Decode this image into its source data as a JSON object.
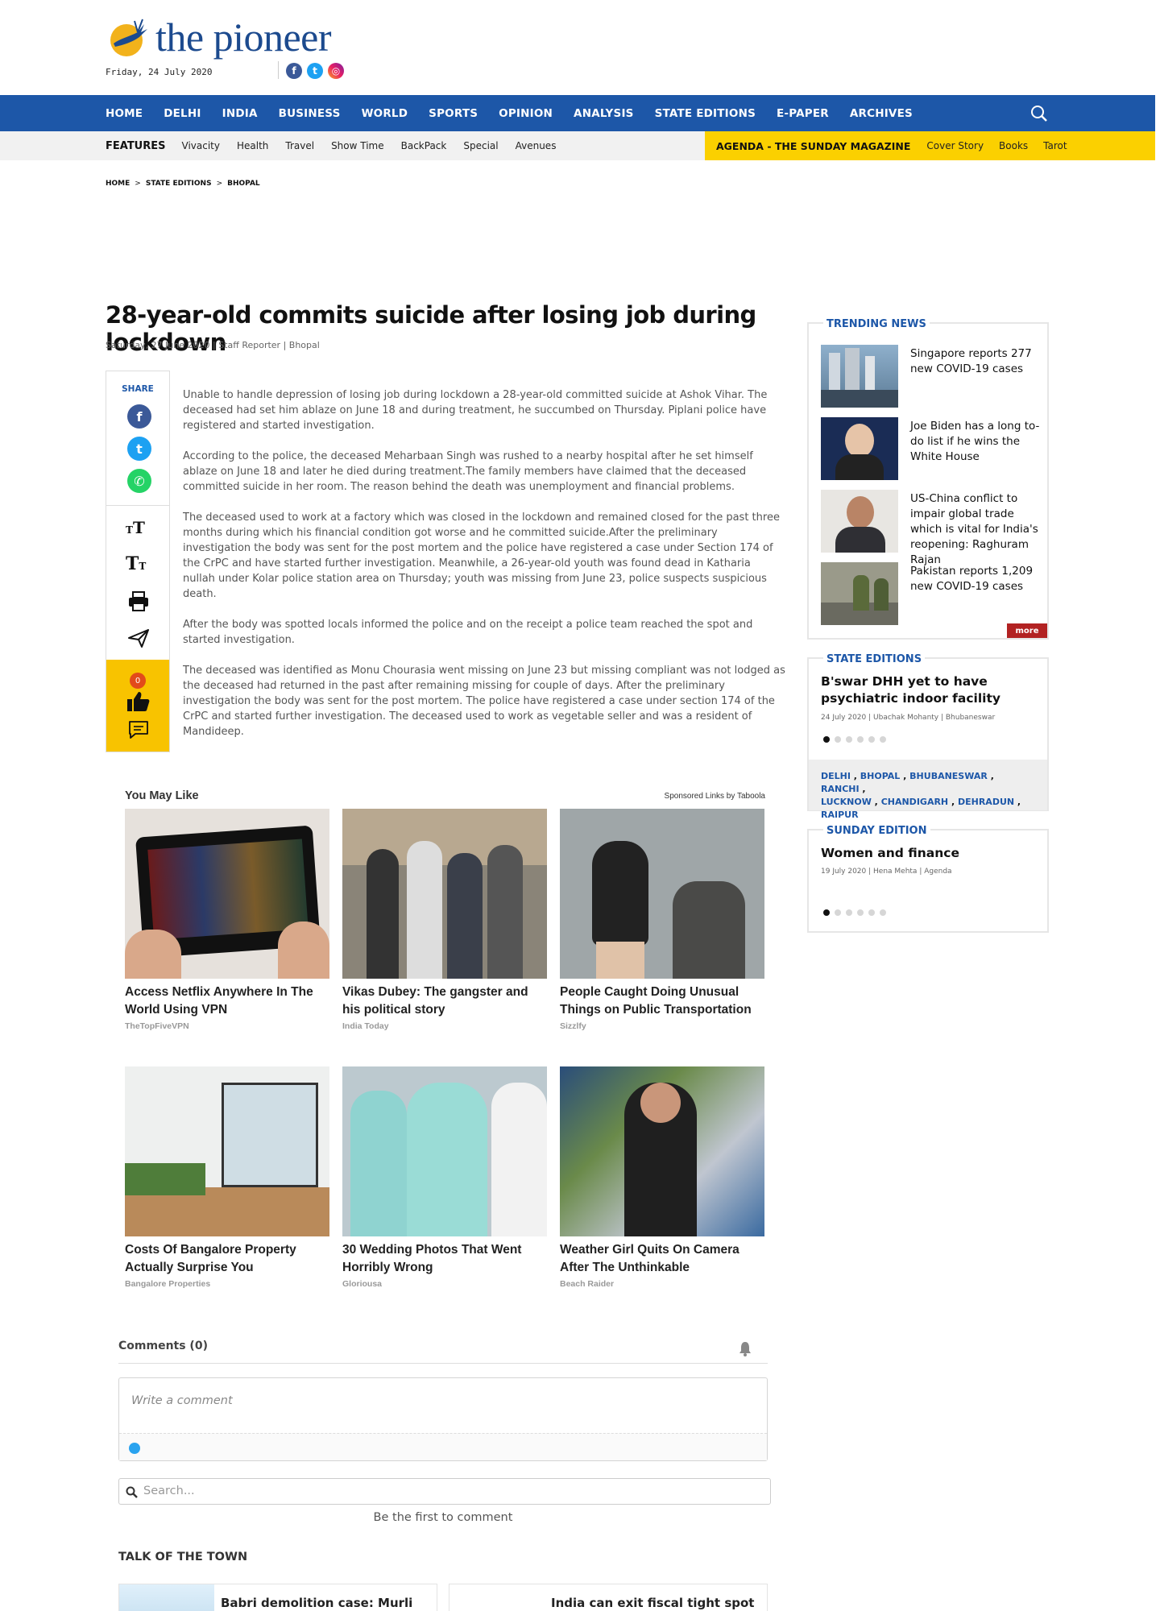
{
  "header": {
    "logo_text": "the pioneer",
    "date": "Friday, 24 July 2020",
    "social": [
      "facebook-icon",
      "twitter-icon",
      "instagram-icon"
    ]
  },
  "nav": {
    "items": [
      "HOME",
      "DELHI",
      "INDIA",
      "BUSINESS",
      "WORLD",
      "SPORTS",
      "OPINION",
      "ANALYSIS",
      "STATE EDITIONS",
      "E-PAPER",
      "ARCHIVES"
    ]
  },
  "subnav": {
    "features_label": "FEATURES",
    "items": [
      "Vivacity",
      "Health",
      "Travel",
      "Show Time",
      "BackPack",
      "Special",
      "Avenues"
    ],
    "agenda_label": "AGENDA - THE SUNDAY MAGAZINE",
    "agenda_items": [
      "Cover Story",
      "Books",
      "Tarot"
    ]
  },
  "breadcrumb": [
    "HOME",
    "STATE EDITIONS",
    "BHOPAL"
  ],
  "article": {
    "headline": "28-year-old commits suicide after losing job during lockdown",
    "meta": "Saturday, 27 June 2020 | Staff Reporter | Bhopal",
    "share_label": "SHARE",
    "like_count": "0",
    "paragraphs": [
      "Unable to handle depression of losing job during lockdown a 28-year-old committed suicide at Ashok Vihar. The deceased had set him ablaze on June 18 and during treatment, he succumbed on Thursday. Piplani police have registered and started investigation.",
      "According to the police, the deceased Meharbaan Singh was rushed to a nearby hospital after he set himself ablaze on June 18 and later he died during treatment.The family members have claimed that the deceased committed suicide in her room. The reason behind the death was unemployment and financial problems.",
      "The deceased used to work at a factory which was closed in the lockdown and remained closed for the past three months during which his financial condition got worse and he committed suicide.After the preliminary investigation the body was sent for the post mortem and the police have registered a case under Section 174 of the CrPC and have started further investigation. Meanwhile, a 26-year-old youth was found dead in Katharia nullah under Kolar police station area on Thursday; youth was missing from June 23, police suspects suspicious death.",
      " After the body was spotted locals informed the police and on the receipt a police team reached the spot and started investigation.",
      "The deceased was identified as Monu Chourasia went missing on June 23 but missing compliant was not lodged as the deceased had returned in the past after remaining missing for couple of days. After the preliminary investigation the body was sent for the post mortem. The police have registered a case under section 174 of the CrPC and started further investigation. The deceased used to work as vegetable seller and was  a resident of Mandideep."
    ]
  },
  "you_may_like": {
    "heading": "You May Like",
    "sponsored": "Sponsored Links by Taboola",
    "cards": [
      {
        "title": "Access Netflix Anywhere In The World Using VPN",
        "source": "TheTopFiveVPN"
      },
      {
        "title": "Vikas Dubey: The gangster and his political story",
        "source": "India Today"
      },
      {
        "title": "People Caught Doing Unusual Things on Public Transportation",
        "source": "Sizzlfy"
      },
      {
        "title": "Costs Of Bangalore Property Actually Surprise You",
        "source": "Bangalore Properties"
      },
      {
        "title": "30 Wedding Photos That Went Horribly Wrong",
        "source": "Gloriousa"
      },
      {
        "title": "Weather Girl Quits On Camera After The Unthinkable",
        "source": "Beach Raider"
      }
    ]
  },
  "comments": {
    "heading": "Comments (0)",
    "placeholder": "Write a comment",
    "search_placeholder": "Search...",
    "empty_text": "Be the first to comment"
  },
  "talk_of_town": {
    "heading": "TALK OF THE TOWN",
    "items": [
      "Babri demolition case: Murli",
      "India can exit fiscal tight spot"
    ]
  },
  "sidebar": {
    "trending": {
      "title": "TRENDING NEWS",
      "items": [
        "Singapore reports 277 new COVID-19 cases",
        "Joe Biden has a long to-do list if he wins the White House",
        "US-China conflict to impair global trade which is vital for India's reopening: Raghuram Rajan",
        "Pakistan reports 1,209 new COVID-19 cases"
      ],
      "more_label": "more"
    },
    "state_editions": {
      "title": "STATE EDITIONS",
      "headline": "B'swar DHH yet to have psychiatric indoor facility",
      "meta": "24 July 2020 | Ubachak Mohanty | Bhubaneswar",
      "cities": [
        "DELHI",
        "BHOPAL",
        "BHUBANESWAR",
        "RANCHI",
        "LUCKNOW",
        "CHANDIGARH",
        "DEHRADUN",
        "RAIPUR"
      ]
    },
    "sunday_edition": {
      "title": "SUNDAY EDITION",
      "headline": "Women and finance",
      "meta": "19 July 2020 | Hena Mehta | Agenda"
    }
  },
  "colors": {
    "nav_blue": "#1d57a8",
    "agenda_yellow": "#fbd000",
    "like_yellow": "#f8c300",
    "more_red": "#b22222"
  }
}
